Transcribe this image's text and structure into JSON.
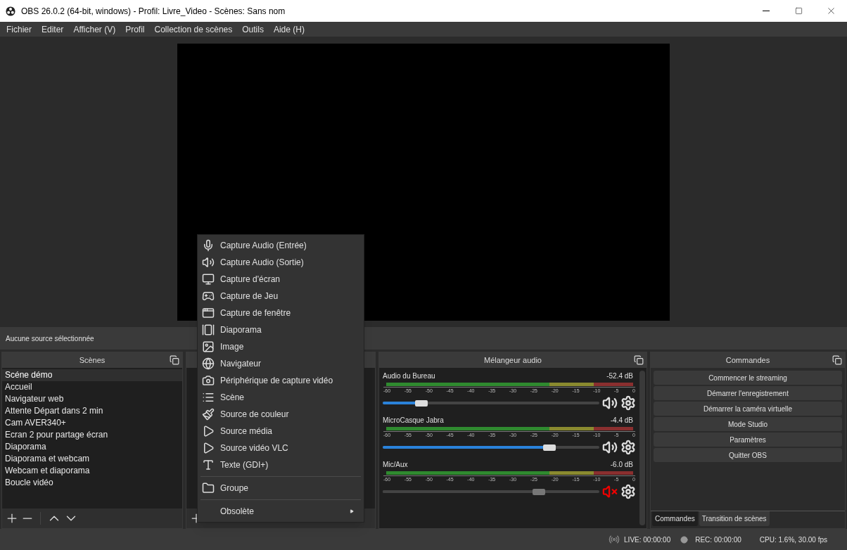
{
  "window": {
    "title": "OBS 26.0.2 (64-bit, windows) - Profil: Livre_Video - Scènes: Sans nom"
  },
  "menu_bar": [
    "Fichier",
    "Editer",
    "Afficher (V)",
    "Profil",
    "Collection de scènes",
    "Outils",
    "Aide (H)"
  ],
  "source_toolbar": {
    "label": "Aucune source sélectionnée"
  },
  "scenes": {
    "title": "Scènes",
    "items": [
      {
        "label": "Scéne démo",
        "selected": true
      },
      {
        "label": "Accueil",
        "selected": false
      },
      {
        "label": "Navigateur web",
        "selected": false
      },
      {
        "label": "Attente Départ dans 2 min",
        "selected": false
      },
      {
        "label": "Cam AVER340+",
        "selected": false
      },
      {
        "label": "Ecran 2 pour partage écran",
        "selected": false
      },
      {
        "label": "Diaporama",
        "selected": false
      },
      {
        "label": "Diaporama et webcam",
        "selected": false
      },
      {
        "label": "Webcam et diaporama",
        "selected": false
      },
      {
        "label": "Boucle vidéo",
        "selected": false
      }
    ]
  },
  "add_source_menu": {
    "sections": [
      [
        {
          "label": "Capture Audio (Entrée)"
        },
        {
          "label": "Capture Audio (Sortie)"
        },
        {
          "label": "Capture d'écran"
        },
        {
          "label": "Capture de Jeu"
        },
        {
          "label": "Capture de fenêtre"
        },
        {
          "label": "Diaporama"
        },
        {
          "label": "Image"
        },
        {
          "label": "Navigateur"
        },
        {
          "label": "Périphérique de capture vidéo"
        },
        {
          "label": "Scène"
        },
        {
          "label": "Source de couleur"
        },
        {
          "label": "Source média"
        },
        {
          "label": "Source vidéo VLC"
        },
        {
          "label": "Texte (GDI+)"
        }
      ],
      [
        {
          "label": "Groupe"
        }
      ],
      [
        {
          "label": "Obsolète",
          "has_submenu": true
        }
      ]
    ]
  },
  "audio_mixer": {
    "title": "Mélangeur audio",
    "channels": [
      {
        "name": "Audio du Bureau",
        "reading": "-52.4 dB",
        "level": 0.18,
        "muted": false,
        "scale": [
          "-60",
          "-55",
          "-50",
          "-45",
          "-40",
          "-35",
          "-30",
          "-25",
          "-20",
          "-15",
          "-10",
          "-5",
          "0"
        ]
      },
      {
        "name": "MicroCasque Jabra",
        "reading": "-4.4 dB",
        "level": 0.77,
        "muted": false,
        "scale": [
          "-60",
          "-55",
          "-50",
          "-45",
          "-40",
          "-35",
          "-30",
          "-25",
          "-20",
          "-15",
          "-10",
          "-5",
          "0"
        ]
      },
      {
        "name": "Mic/Aux",
        "reading": "-6.0 dB",
        "level": 0.72,
        "muted": true,
        "scale": [
          "-60",
          "-55",
          "-50",
          "-45",
          "-40",
          "-35",
          "-30",
          "-25",
          "-20",
          "-15",
          "-10",
          "-5",
          "0"
        ]
      }
    ]
  },
  "controls": {
    "title": "Commandes",
    "buttons": [
      "Commencer le streaming",
      "Démarrer l'enregistrement",
      "Démarrer la caméra virtuelle",
      "Mode Studio",
      "Paramètres",
      "Quitter OBS"
    ],
    "tabs": [
      {
        "label": "Commandes",
        "selected": true
      },
      {
        "label": "Transition de scènes",
        "selected": false
      }
    ]
  },
  "status_bar": {
    "live": "LIVE: 00:00:00",
    "rec": "REC: 00:00:00",
    "cpu": "CPU: 1.6%, 30.00 fps"
  }
}
